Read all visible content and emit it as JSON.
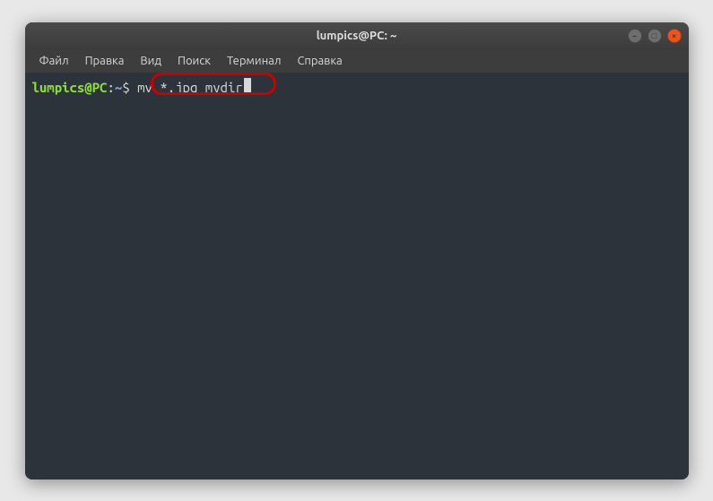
{
  "window": {
    "title": "lumpics@PC: ~"
  },
  "menubar": {
    "items": [
      {
        "label": "Файл"
      },
      {
        "label": "Правка"
      },
      {
        "label": "Вид"
      },
      {
        "label": "Поиск"
      },
      {
        "label": "Терминал"
      },
      {
        "label": "Справка"
      }
    ]
  },
  "terminal": {
    "prompt": {
      "user_host": "lumpics@PC",
      "colon": ":",
      "path": "~",
      "dollar": "$ "
    },
    "command": "mv *.jpg mydir"
  },
  "colors": {
    "prompt_user": "#8ae234",
    "prompt_path": "#729fcf",
    "close_button": "#e95420",
    "highlight": "#cc0000",
    "terminal_bg": "#2d333b"
  }
}
